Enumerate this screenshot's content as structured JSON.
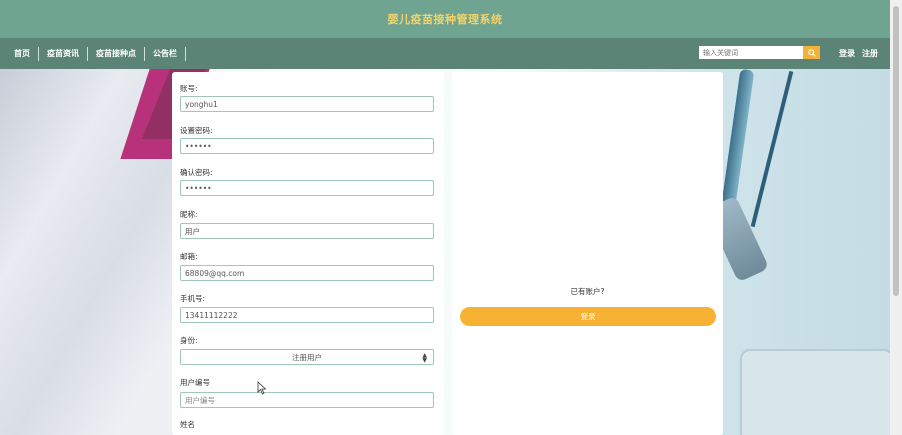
{
  "header": {
    "title": "婴儿疫苗接种管理系统"
  },
  "nav": {
    "items": [
      {
        "label": "首页"
      },
      {
        "label": "疫苗资讯"
      },
      {
        "label": "疫苗接种点"
      },
      {
        "label": "公告栏"
      }
    ],
    "search_placeholder": "输入关键词",
    "login_label": "登录",
    "register_label": "注册"
  },
  "form": {
    "fields": [
      {
        "label": "账号:",
        "value": "yonghu1"
      },
      {
        "label": "设置密码:",
        "value": "••••••"
      },
      {
        "label": "确认密码:",
        "value": "••••••"
      },
      {
        "label": "昵称:",
        "value": "用户"
      },
      {
        "label": "邮箱:",
        "value": "68809@qq.com"
      },
      {
        "label": "手机号:",
        "value": "13411112222"
      }
    ],
    "identity": {
      "label": "身份:",
      "selected": "注册用户"
    },
    "user_no": {
      "label": "用户编号",
      "placeholder": "用户编号"
    },
    "name": {
      "label": "姓名"
    }
  },
  "side": {
    "has_account_text": "已有账户?",
    "login_button": "登录"
  },
  "colors": {
    "header_bg": "#6fa491",
    "title": "#f3d36a",
    "nav_bg": "#5b8477",
    "accent": "#f7b234",
    "input_border": "#9fc8b5"
  }
}
